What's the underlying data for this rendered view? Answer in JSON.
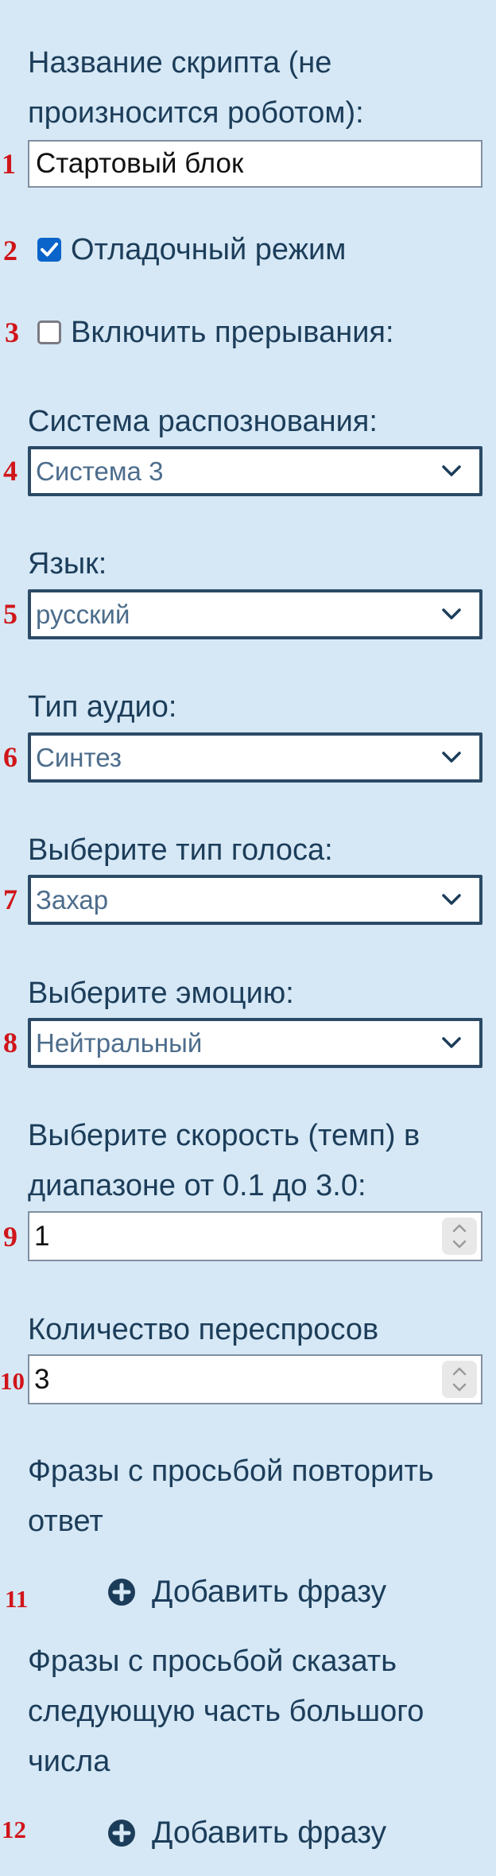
{
  "script_name": {
    "label": "Название скрипта (не произносится роботом):",
    "value": "Стартовый блок",
    "marker": "1"
  },
  "debug_mode": {
    "label": "Отладочный режим",
    "checked": true,
    "marker": "2"
  },
  "interrupts": {
    "label": "Включить прерывания:",
    "checked": false,
    "marker": "3"
  },
  "recognition": {
    "label": "Система распознования:",
    "value": "Система 3",
    "marker": "4"
  },
  "language": {
    "label": "Язык:",
    "value": "русский",
    "marker": "5"
  },
  "audio_type": {
    "label": "Тип аудио:",
    "value": "Синтез",
    "marker": "6"
  },
  "voice": {
    "label": "Выберите тип голоса:",
    "value": "Захар",
    "marker": "7"
  },
  "emotion": {
    "label": "Выберите эмоцию:",
    "value": "Нейтральный",
    "marker": "8"
  },
  "speed": {
    "label": "Выберите скорость (темп) в диапазоне от 0.1 до 3.0:",
    "value": "1",
    "marker": "9"
  },
  "reprompts": {
    "label": "Количество переспросов",
    "value": "3",
    "marker": "10"
  },
  "repeat_phrases": {
    "label": "Фразы с просьбой повторить ответ",
    "button": "Добавить фразу",
    "marker": "11"
  },
  "next_part_phrases": {
    "label": "Фразы с просьбой сказать следующую часть большого числа",
    "button": "Добавить фразу",
    "marker": "12"
  },
  "colors": {
    "background": "#d6e8f5",
    "text": "#1c3d5a",
    "marker": "#d0151a",
    "checkbox_on": "#0a64c9"
  },
  "icons": {
    "select_arrow": "chevron-down-icon",
    "add": "plus-circle-icon",
    "check": "checkmark-icon"
  }
}
